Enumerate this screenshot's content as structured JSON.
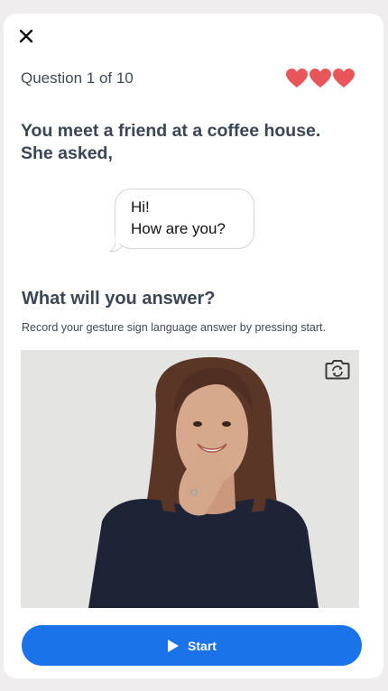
{
  "header": {
    "close_icon": "close-icon",
    "progress": "Question 1 of 10",
    "lives": 3,
    "lives_icon": "heart-icon",
    "heart_color": "#e8565a"
  },
  "question": {
    "prompt_line1": "You meet a friend at a coffee house.",
    "prompt_line2": "She asked,",
    "bubble_line1": "Hi!",
    "bubble_line2": "How are you?"
  },
  "answer": {
    "heading": "What will you answer?",
    "instruction": "Record your gesture sign language answer by pressing start."
  },
  "video": {
    "camera_icon": "camera-switch-icon"
  },
  "actions": {
    "start_label": "Start",
    "start_icon": "play-icon",
    "accent_color": "#1a73e8"
  }
}
